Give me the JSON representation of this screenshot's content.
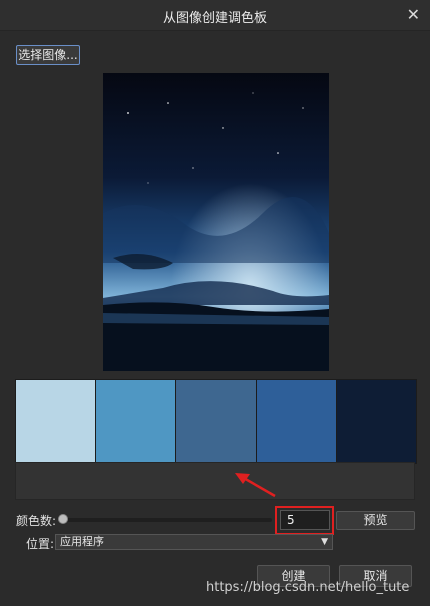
{
  "window": {
    "title": "从图像创建调色板"
  },
  "buttons": {
    "choose_image": "选择图像...",
    "preview": "预览",
    "create": "创建",
    "cancel": "取消"
  },
  "palette": {
    "colors": [
      "#b8d6e6",
      "#4f97c3",
      "#3e6790",
      "#2e5f99",
      "#0e1d35"
    ]
  },
  "controls": {
    "color_count_label": "颜色数:",
    "color_count_value": "5",
    "position_label": "位置:",
    "position_value": "应用程序"
  },
  "watermark": "https://blog.csdn.net/hello_tute",
  "colors": {
    "annotation_red": "#e02020"
  }
}
